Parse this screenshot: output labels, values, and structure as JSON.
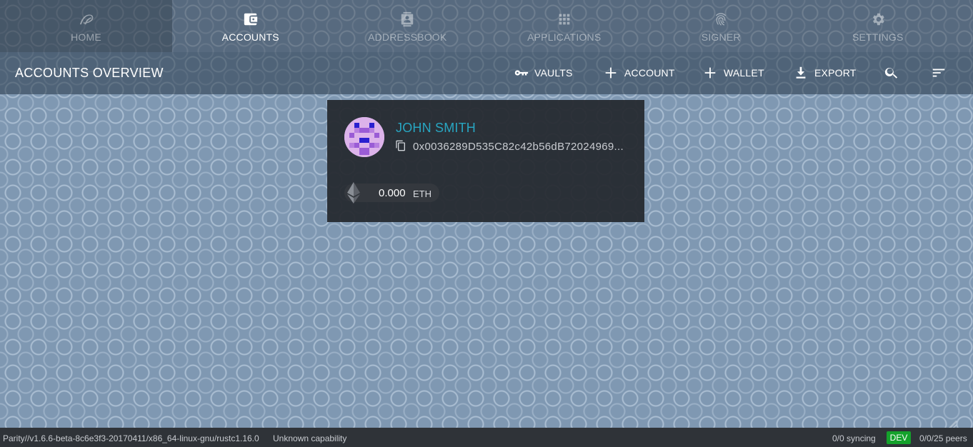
{
  "nav": {
    "tabs": [
      {
        "label": "HOME",
        "icon": "parity-logo-icon"
      },
      {
        "label": "ACCOUNTS",
        "icon": "wallet-icon"
      },
      {
        "label": "ADDRESSBOOK",
        "icon": "contact-card-icon"
      },
      {
        "label": "APPLICATIONS",
        "icon": "apps-grid-icon"
      },
      {
        "label": "SIGNER",
        "icon": "fingerprint-icon"
      },
      {
        "label": "SETTINGS",
        "icon": "gear-icon"
      }
    ],
    "active": "ACCOUNTS"
  },
  "header": {
    "title": "ACCOUNTS OVERVIEW",
    "actions": {
      "vaults": "VAULTS",
      "account": "ACCOUNT",
      "wallet": "WALLET",
      "export": "EXPORT"
    }
  },
  "account": {
    "name": "JOHN SMITH",
    "address": "0x0036289D535C82c42b56dB72024969...",
    "balance": "0.000",
    "unit": "ETH"
  },
  "status": {
    "version": "Parity//v1.6.6-beta-8c6e3f3-20170411/x86_64-linux-gnu/rustc1.16.0",
    "capability": "Unknown capability",
    "syncing": "0/0 syncing",
    "badge": "DEV",
    "peers": "0/0/25 peers"
  },
  "colors": {
    "accent": "#28a6c2",
    "dev_badge": "#14a22b",
    "card_bg": "#26292f"
  }
}
